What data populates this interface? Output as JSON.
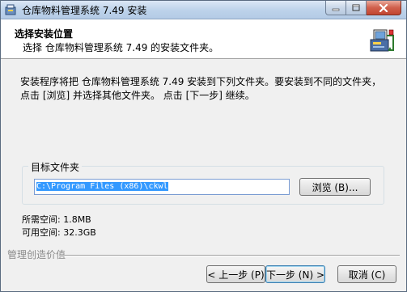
{
  "window": {
    "title": "仓库物料管理系统 7.49 安装"
  },
  "header": {
    "title": "选择安装位置",
    "subtitle": "选择 仓库物料管理系统 7.49 的安装文件夹。",
    "icon": "installer-box-icon"
  },
  "body": {
    "intro_line1": "安装程序将把 仓库物料管理系统 7.49 安装到下列文件夹。要安装到不同的文件夹，",
    "intro_line2": "点击 [浏览] 并选择其他文件夹。 点击 [下一步] 继续。"
  },
  "destination": {
    "group_label": "目标文件夹",
    "path_value": "C:\\Program Files (x86)\\ckwl",
    "browse_label": "浏览 (B)..."
  },
  "space": {
    "required": "所需空间: 1.8MB",
    "available": "可用空间: 32.3GB"
  },
  "footer": {
    "brand": "管理创造价值",
    "back_label": "< 上一步 (P)",
    "next_label": "下一步 (N) >",
    "cancel_label": "取消 (C)"
  },
  "colors": {
    "selection": "#3399ff",
    "close_button": "#c9503a",
    "titlebar": "#bcd2ea"
  }
}
